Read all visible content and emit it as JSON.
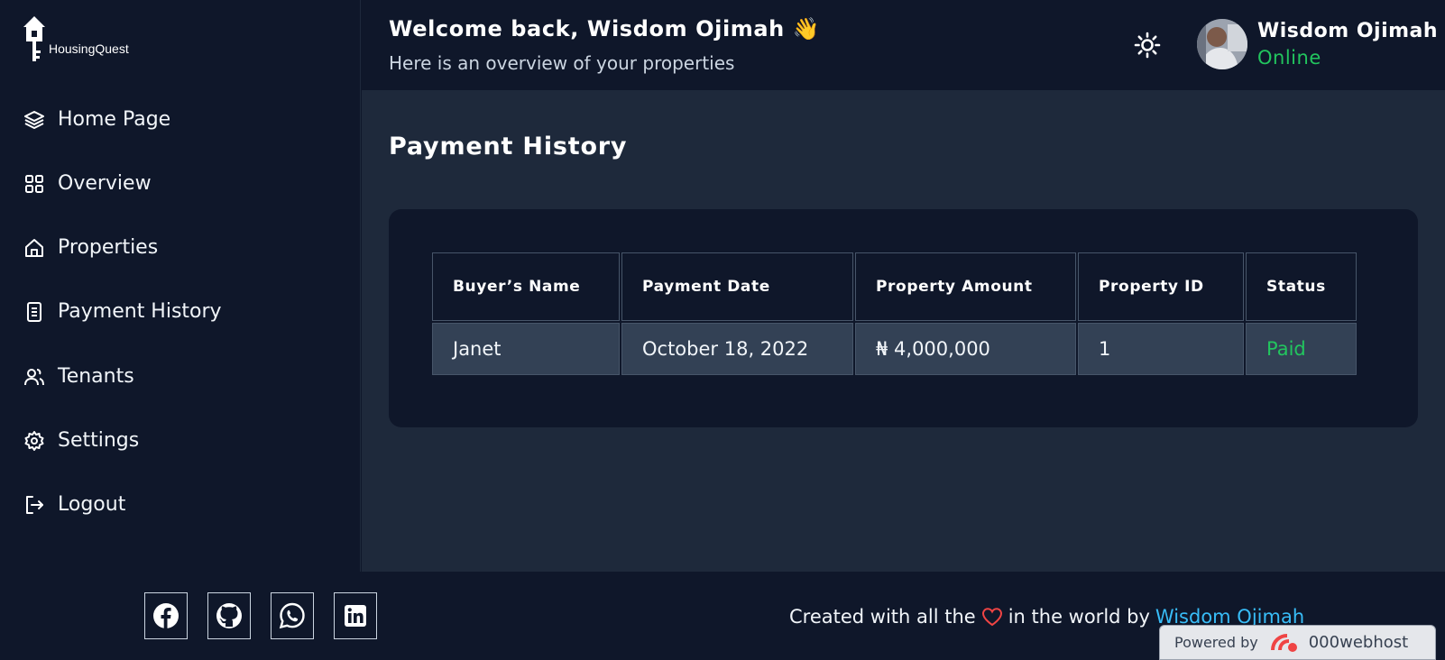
{
  "sidebar": {
    "logo_text": "HousingQuest",
    "items": [
      {
        "label": "Home Page",
        "icon": "layers-icon"
      },
      {
        "label": "Overview",
        "icon": "grid-icon"
      },
      {
        "label": "Properties",
        "icon": "home-icon"
      },
      {
        "label": "Payment History",
        "icon": "document-icon"
      },
      {
        "label": "Tenants",
        "icon": "users-icon"
      },
      {
        "label": "Settings",
        "icon": "gear-icon"
      },
      {
        "label": "Logout",
        "icon": "logout-icon"
      }
    ]
  },
  "header": {
    "welcome": "Welcome back, Wisdom Ojimah 👋",
    "subtitle": "Here is an overview of your properties",
    "user_name": "Wisdom Ojimah",
    "user_status": "Online"
  },
  "main": {
    "title": "Payment History",
    "table": {
      "headers": [
        "Buyer’s Name",
        "Payment Date",
        "Property Amount",
        "Property ID",
        "Status"
      ],
      "rows": [
        [
          "Janet",
          "October 18, 2022",
          "₦ 4,000,000",
          "1",
          "Paid"
        ]
      ]
    }
  },
  "footer": {
    "credit_prefix": "Created with all the",
    "credit_middle": "in the world by",
    "author": "Wisdom Ojimah",
    "socials": [
      "facebook-icon",
      "github-icon",
      "whatsapp-icon",
      "linkedin-icon"
    ]
  },
  "badge": {
    "powered": "Powered by",
    "brand": "000webhost"
  },
  "colors": {
    "background": "#0f172a",
    "panel": "#1e293b",
    "row": "#334155",
    "accent_green": "#22c55e",
    "link_blue": "#38bdf8",
    "heart": "#ef4444"
  }
}
